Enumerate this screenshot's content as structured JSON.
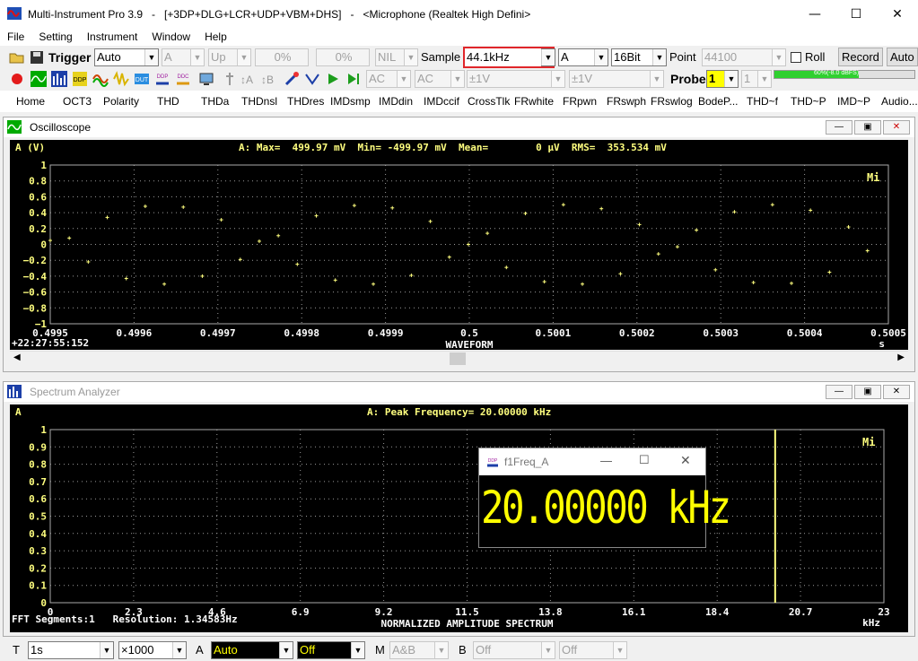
{
  "window": {
    "title": "Multi-Instrument Pro 3.9   -   [+3DP+DLG+LCR+UDP+VBM+DHS]   -   <Microphone (Realtek High Defini>",
    "minimize": "—",
    "maximize": "☐",
    "close": "✕"
  },
  "menu": [
    "File",
    "Setting",
    "Instrument",
    "Window",
    "Help"
  ],
  "toolbar1": {
    "trigger_label": "Trigger",
    "trigger_mode": "Auto",
    "channel": "A",
    "edge": "Up",
    "pct1": "0%",
    "pct2": "0%",
    "nil": "NIL",
    "sample_label": "Sample",
    "sample_rate": "44.1kHz",
    "sample_channel": "A",
    "bits": "16Bit",
    "point_label": "Point",
    "points": "44100",
    "roll_label": "Roll",
    "record_label": "Record",
    "auto_label": "Auto"
  },
  "toolbar2": {
    "coupling_a": "AC",
    "coupling_b": "AC",
    "range_a": "±1V",
    "range_b": "±1V",
    "probe_label": "Probe",
    "probe_a": "1",
    "probe_b": "1",
    "level_text": "60%(-8.0 dBFS)",
    "level": 0.6
  },
  "nav": [
    "Home",
    "OCT3",
    "Polarity",
    "THD",
    "THDa",
    "THDnsl",
    "THDres",
    "IMDsmp",
    "IMDdin",
    "IMDccif",
    "CrossTlk",
    "FRwhite",
    "FRpwn",
    "FRswph",
    "FRswlog",
    "BodeP...",
    "THD~f",
    "THD~P",
    "IMD~P",
    "Audio..."
  ],
  "oscilloscope": {
    "title": "Oscilloscope",
    "ylabel": "A (V)",
    "stats": "A: Max=  499.97 mV  Min= -499.97 mV  Mean=        0 µV  RMS=  353.534 mV",
    "y_ticks": [
      "1",
      "0.8",
      "0.6",
      "0.4",
      "0.2",
      "0",
      "−0.2",
      "−0.4",
      "−0.6",
      "−0.8",
      "−1"
    ],
    "x_ticks": [
      "0.4995",
      "0.4996",
      "0.4997",
      "0.4998",
      "0.4999",
      "0.5",
      "0.5001",
      "0.5002",
      "0.5003",
      "0.5004",
      "0.5005"
    ],
    "x_unit": "s",
    "timestamp": "+22:27:55:152",
    "caption": "WAVEFORM",
    "badge": "Mi"
  },
  "spectrum": {
    "title": "Spectrum Analyzer",
    "ylabel": "A",
    "stats": "A: Peak Frequency= 20.00000 kHz",
    "y_ticks": [
      "1",
      "0.9",
      "0.8",
      "0.7",
      "0.6",
      "0.5",
      "0.4",
      "0.3",
      "0.2",
      "0.1",
      "0"
    ],
    "x_ticks": [
      "0",
      "2.3",
      "4.6",
      "6.9",
      "9.2",
      "11.5",
      "13.8",
      "16.1",
      "18.4",
      "20.7",
      "23"
    ],
    "x_unit": "kHz",
    "segments": "FFT Segments:1   Resolution: 1.34583Hz",
    "caption": "NORMALIZED AMPLITUDE SPECTRUM",
    "badge": "Mi"
  },
  "freq_popup": {
    "title": "f1Freq_A",
    "value": "20.00000 kHz"
  },
  "statusbar": {
    "t_label": "T",
    "t_value": "1s",
    "mult": "×1000",
    "a_label": "A",
    "a_mode": "Auto",
    "a_off": "Off",
    "m_label": "M",
    "m_value": "A&B",
    "b_label": "B",
    "b_off": "Off",
    "c_off": "Off"
  },
  "chart_data": [
    {
      "type": "scatter",
      "title": "WAVEFORM",
      "ylabel": "A (V)",
      "xlabel": "s",
      "xlim": [
        0.4995,
        0.5005
      ],
      "ylim": [
        -1,
        1
      ],
      "grid": true,
      "x": [
        0.4995,
        0.499522676,
        0.499545351,
        0.499568027,
        0.499590703,
        0.499613379,
        0.499636054,
        0.49965873,
        0.499681406,
        0.499704082,
        0.499726757,
        0.499749433,
        0.499772109,
        0.499794785,
        0.49981746,
        0.499840136,
        0.499862812,
        0.499885488,
        0.499908163,
        0.499930839,
        0.499953515,
        0.49997619,
        0.499998866,
        0.500021542,
        0.500044218,
        0.500066893,
        0.500089569,
        0.500112245,
        0.500134921,
        0.500157596,
        0.500180272,
        0.500202948,
        0.500225624,
        0.500248299,
        0.500270975,
        0.500293651,
        0.500316327,
        0.500339002,
        0.500361678,
        0.500384354,
        0.50040703,
        0.500429705,
        0.500452381,
        0.500475057
      ],
      "values": [
        0.05,
        0.08,
        -0.22,
        0.34,
        -0.43,
        0.48,
        -0.5,
        0.47,
        -0.4,
        0.31,
        -0.19,
        0.04,
        0.11,
        -0.25,
        0.36,
        -0.45,
        0.49,
        -0.5,
        0.46,
        -0.39,
        0.29,
        -0.16,
        0.0,
        0.14,
        -0.29,
        0.39,
        -0.47,
        0.5,
        -0.5,
        0.45,
        -0.37,
        0.25,
        -0.12,
        -0.03,
        0.18,
        -0.32,
        0.41,
        -0.48,
        0.5,
        -0.49,
        0.43,
        -0.35,
        0.22,
        -0.08
      ]
    },
    {
      "type": "bar",
      "title": "NORMALIZED AMPLITUDE SPECTRUM",
      "ylabel": "A",
      "xlabel": "kHz",
      "xlim": [
        0,
        23
      ],
      "ylim": [
        0,
        1
      ],
      "grid": true,
      "x": [
        20.0
      ],
      "values": [
        1.0
      ]
    }
  ]
}
